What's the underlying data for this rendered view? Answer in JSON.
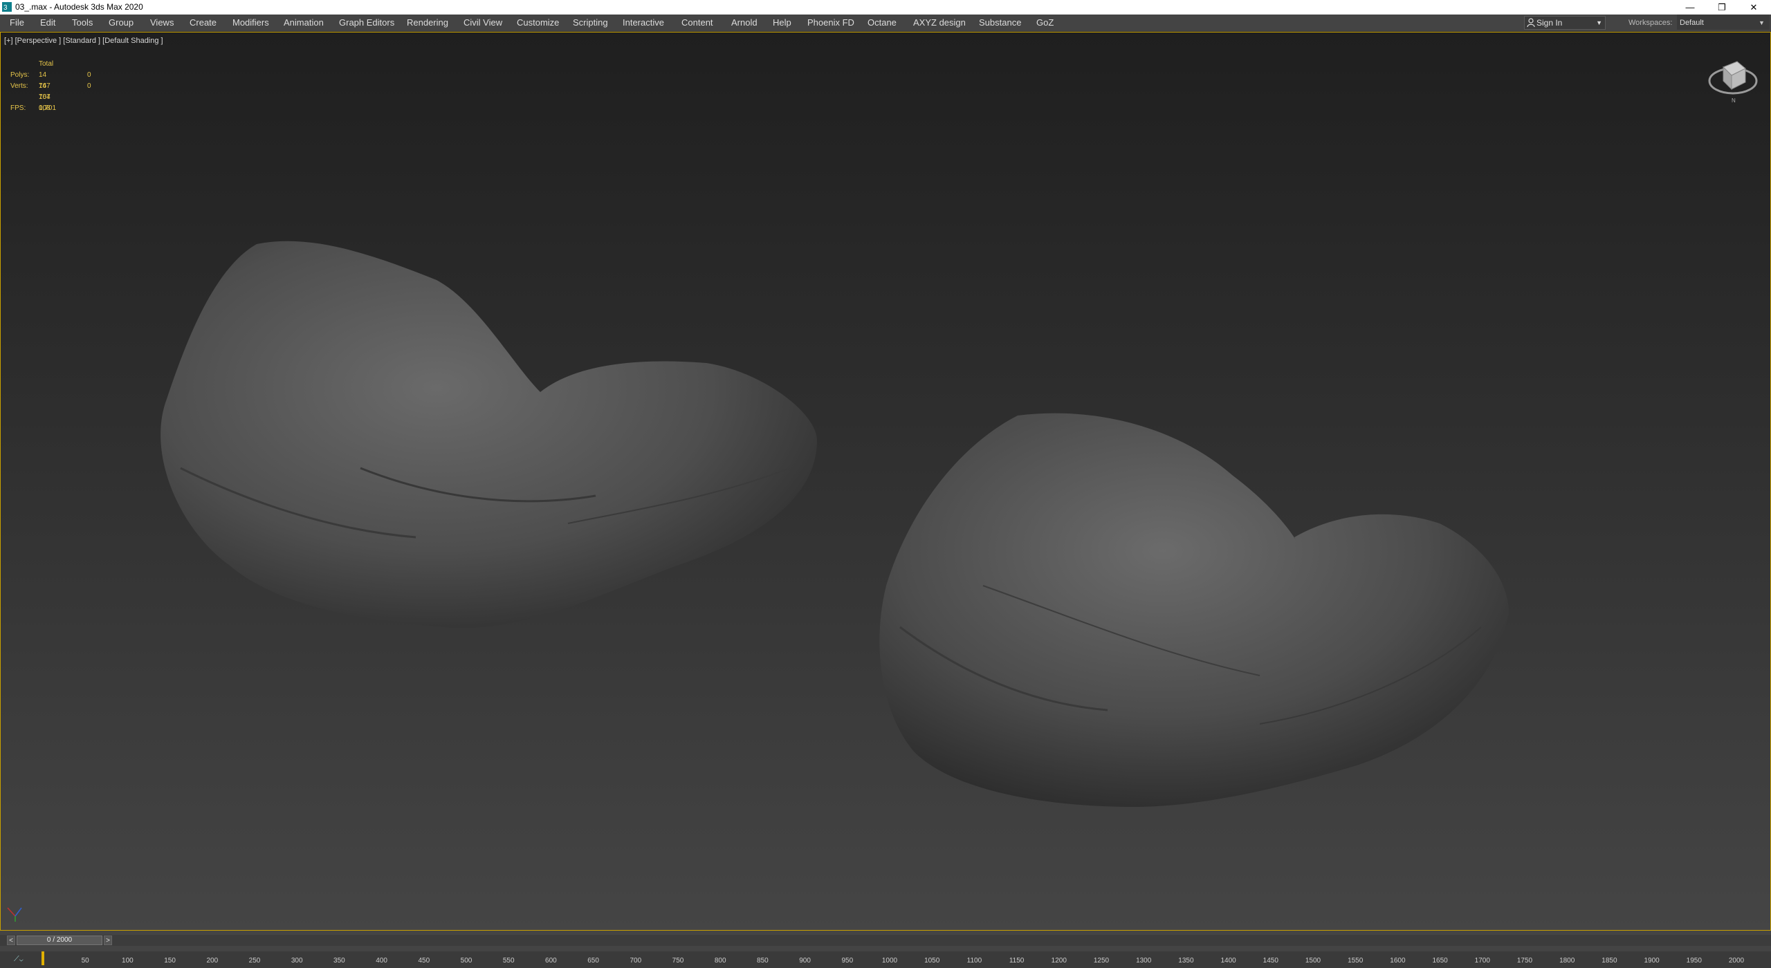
{
  "window": {
    "title": "03_.max - Autodesk 3ds Max 2020",
    "minimize": "—",
    "restore": "❐",
    "close": "✕"
  },
  "menu": [
    "File",
    "Edit",
    "Tools",
    "Group",
    "Views",
    "Create",
    "Modifiers",
    "Animation",
    "Graph Editors",
    "Rendering",
    "Civil View",
    "Customize",
    "Scripting",
    "Interactive",
    "Content",
    "Arnold",
    "Help",
    "Phoenix FD",
    "Octane",
    "AXYZ design",
    "Substance",
    "GoZ"
  ],
  "account": {
    "sign_in": "Sign In"
  },
  "workspaces": {
    "label": "Workspaces:",
    "value": "Default"
  },
  "viewport": {
    "label": "[+] [Perspective ] [Standard ] [Default Shading ]",
    "stats": {
      "header": "Total",
      "polys_label": "Polys:",
      "polys_total": "14 767 104",
      "polys_selected": "0",
      "verts_label": "Verts:",
      "verts_total": "14 767 108",
      "verts_selected": "0",
      "fps_label": "FPS:",
      "fps_value": "0,701"
    }
  },
  "timeline": {
    "frame_display": "0 / 2000",
    "prev": "<",
    "next": ">",
    "ticks": [
      "50",
      "100",
      "150",
      "200",
      "250",
      "300",
      "350",
      "400",
      "450",
      "500",
      "550",
      "600",
      "650",
      "700",
      "750",
      "800",
      "850",
      "900",
      "950",
      "1000",
      "1050",
      "1100",
      "1150",
      "1200",
      "1250",
      "1300",
      "1350",
      "1400",
      "1450",
      "1500",
      "1550",
      "1600",
      "1650",
      "1700",
      "1750",
      "1800",
      "1850",
      "1900",
      "1950",
      "2000"
    ]
  },
  "colors": {
    "accent": "#c8a000",
    "stats": "#e6c54a",
    "menubar": "#444444"
  }
}
